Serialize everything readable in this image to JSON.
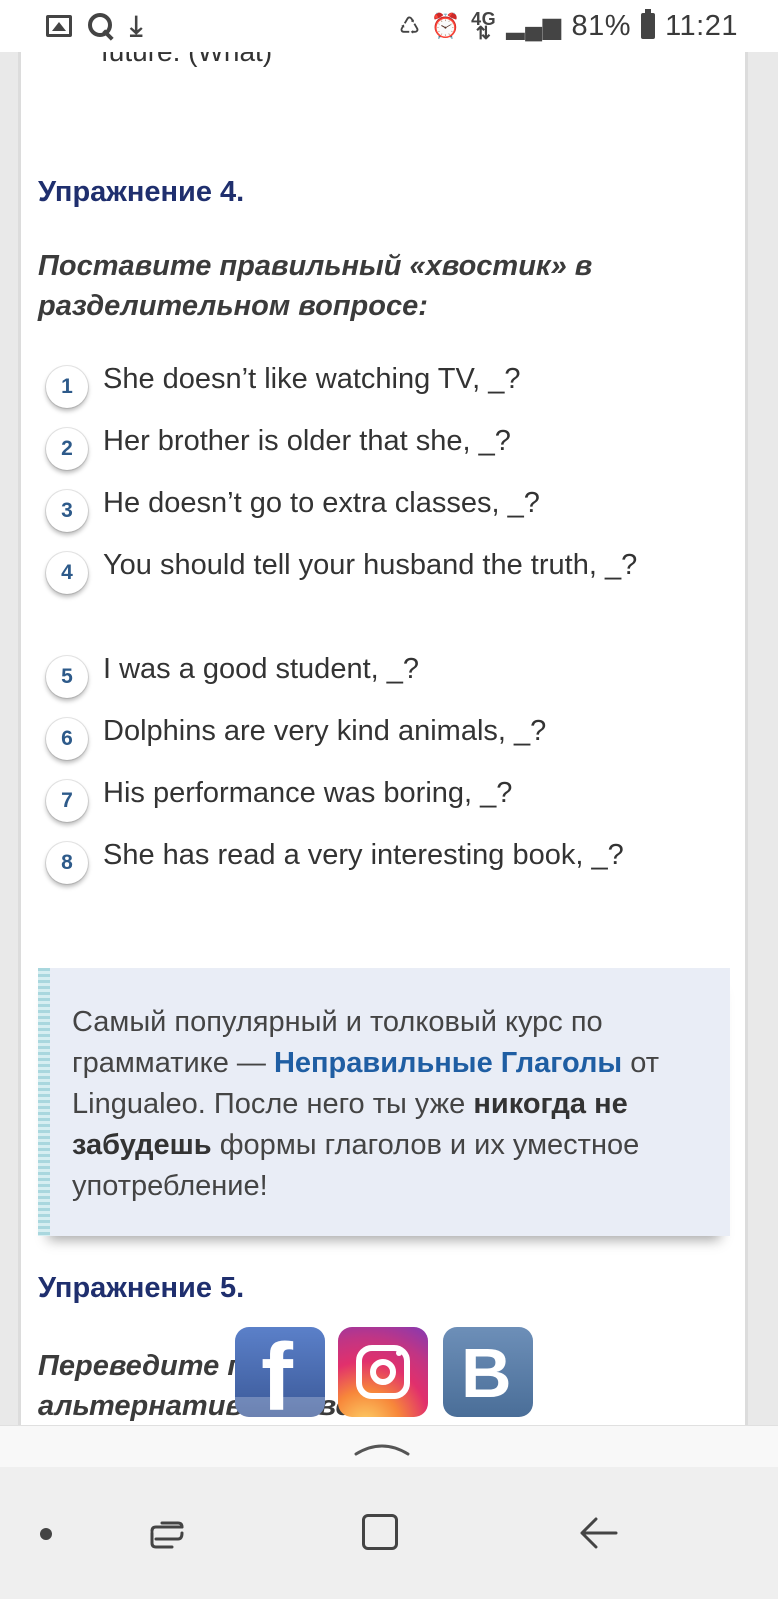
{
  "status_bar": {
    "left_icons": [
      "gallery-icon",
      "search-icon",
      "download-icon"
    ],
    "right_icons": [
      "recycle-icon",
      "alarm-icon"
    ],
    "network": "4G",
    "battery": "81%",
    "time": "11:21"
  },
  "article": {
    "previous_line": "future. (What)",
    "exercise4": {
      "heading": "Упражнение 4.",
      "task": "Поставите правильный «хвостик» в разделительном вопросе:",
      "items": [
        {
          "num": "1",
          "text": "She doesn’t like watching TV, _?"
        },
        {
          "num": "2",
          "text": "Her brother is older that she, _?"
        },
        {
          "num": "3",
          "text": "He doesn’t go to extra classes, _?"
        },
        {
          "num": "4",
          "text": "You should tell your husband the truth, _?"
        },
        {
          "num": "5",
          "text": "I was a good student, _?"
        },
        {
          "num": "6",
          "text": "Dolphins are very kind animals, _?"
        },
        {
          "num": "7",
          "text": "His performance was boring, _?"
        },
        {
          "num": "8",
          "text": "She has read a very interesting book, _?"
        }
      ]
    },
    "promo": {
      "part1": "Самый популярный и толковый курс по грамматике — ",
      "link": "Неправильные Глаголы",
      "part2": " от Lingualeo. После него ты уже ",
      "bold": "никогда не забудешь",
      "part3": " формы глаголов и их уместное употребление!"
    },
    "exercise5": {
      "heading": "Упражнение 5.",
      "task_line1_start": "Переведите п",
      "task_line1_mid": "ож",
      "task_line1_mid2": "в",
      "task_line1_end": "е",
      "task_line2": "альтернативного воп"
    }
  },
  "social": {
    "facebook_letter": "f",
    "vk_letter": "B"
  },
  "colors": {
    "heading": "#1f2f6e",
    "link": "#1f5ea3",
    "number": "#2d5a8a",
    "promo_bg": "#e9edf6"
  }
}
